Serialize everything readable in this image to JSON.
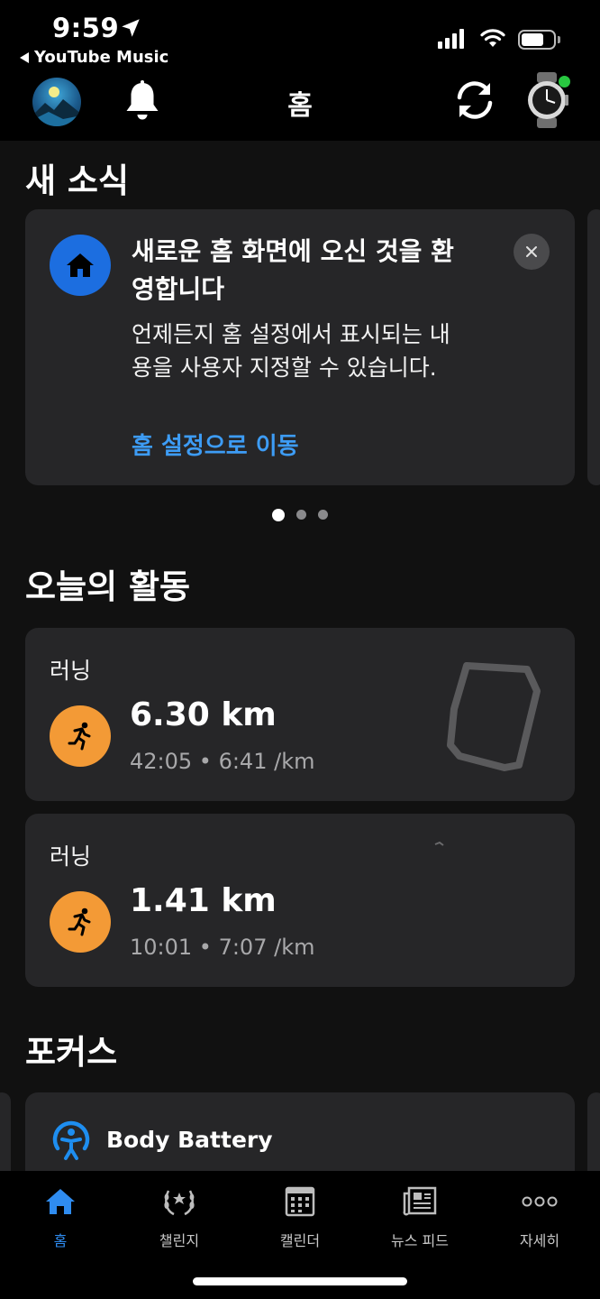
{
  "status_bar": {
    "time": "9:59",
    "back_app": "YouTube Music"
  },
  "header": {
    "title": "홈"
  },
  "news": {
    "section_title": "새 소식",
    "card_title": "새로운 홈 화면에 오신 것을 환영합니다",
    "card_body": "언제든지 홈 설정에서 표시되는 내용을 사용자 지정할 수 있습니다.",
    "card_link": "홈 설정으로 이동",
    "page_count": 3,
    "active_page": 1
  },
  "activities": {
    "section_title": "오늘의 활동",
    "items": [
      {
        "type": "러닝",
        "distance": "6.30 km",
        "meta": "42:05 • 6:41 /km"
      },
      {
        "type": "러닝",
        "distance": "1.41 km",
        "meta": "10:01 • 7:07 /km"
      }
    ]
  },
  "focus": {
    "section_title": "포커스",
    "card_label": "Body Battery"
  },
  "tabbar": {
    "tabs": [
      {
        "label": "홈",
        "icon": "home-icon",
        "active": true
      },
      {
        "label": "챌린지",
        "icon": "laurel-icon",
        "active": false
      },
      {
        "label": "캘린더",
        "icon": "calendar-icon",
        "active": false
      },
      {
        "label": "뉴스 피드",
        "icon": "news-feed-icon",
        "active": false
      },
      {
        "label": "자세히",
        "icon": "more-icon",
        "active": false
      }
    ]
  },
  "colors": {
    "accent_blue": "#2f8cf0",
    "link_blue": "#3d9cf5",
    "running_orange": "#f39a36",
    "card_bg": "#262628",
    "page_bg": "#111111"
  }
}
